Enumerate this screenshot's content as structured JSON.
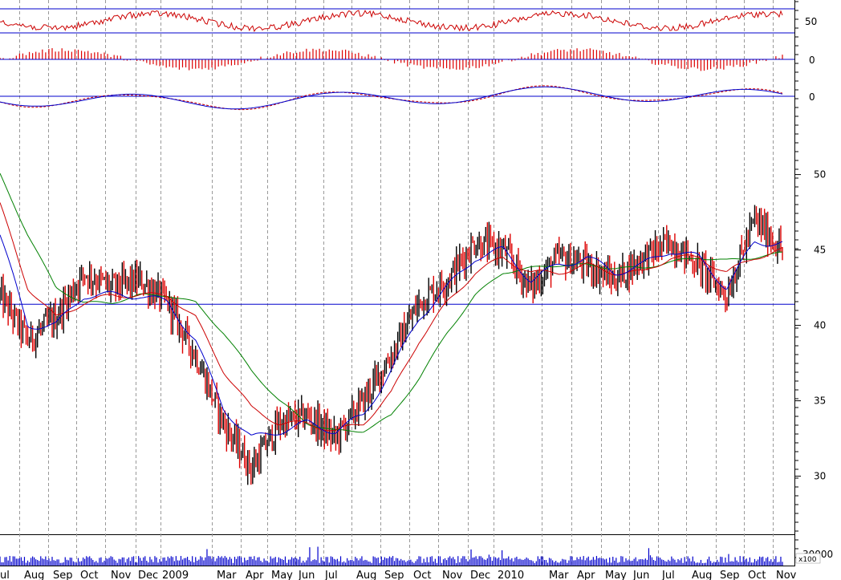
{
  "chart_data": [
    {
      "panel": "oscillator-1",
      "type": "line",
      "reference_levels": [
        50
      ],
      "y_tick_labels": [
        "50"
      ],
      "colors": {
        "line": "#cc0000",
        "reference": "#0000cc"
      }
    },
    {
      "panel": "histogram",
      "type": "bar",
      "reference_levels": [
        0
      ],
      "y_tick_labels": [
        "0"
      ],
      "colors": {
        "bars": "#dd0000",
        "reference": "#0000cc"
      }
    },
    {
      "panel": "oscillator-2",
      "type": "line",
      "reference_levels": [
        0
      ],
      "y_tick_labels": [
        "0"
      ],
      "colors": {
        "line": "#0000cc",
        "signal": "#cc0000",
        "reference": "#0000cc"
      }
    },
    {
      "panel": "price",
      "type": "candlestick",
      "ylim": [
        27,
        52
      ],
      "y_ticks": [
        30,
        35,
        40,
        45,
        50
      ],
      "y_tick_labels": [
        "30",
        "35",
        "40",
        "45",
        "50"
      ],
      "support_level": 41.4,
      "x": [
        "2008-07",
        "2008-08",
        "2008-09",
        "2008-10",
        "2008-11",
        "2008-12",
        "2009-01",
        "2009-02",
        "2009-03",
        "2009-04",
        "2009-05",
        "2009-06",
        "2009-07",
        "2009-08",
        "2009-09",
        "2009-10",
        "2009-11",
        "2009-12",
        "2010-01",
        "2010-02",
        "2010-03",
        "2010-04",
        "2010-05",
        "2010-06",
        "2010-07",
        "2010-08",
        "2010-09",
        "2010-10",
        "2010-11"
      ],
      "close": [
        42.0,
        39.0,
        40.5,
        43.5,
        42.5,
        43.0,
        41.5,
        38.0,
        33.5,
        30.5,
        33.5,
        34.0,
        32.5,
        35.0,
        38.0,
        41.5,
        43.0,
        45.5,
        45.0,
        42.5,
        44.5,
        44.0,
        43.0,
        44.5,
        45.5,
        44.0,
        42.0,
        47.0,
        45.0
      ],
      "series": [
        {
          "name": "",
          "kind": "moving-average",
          "color": "#0000cc",
          "values": [
            46.0,
            40.0,
            40.0,
            42.0,
            42.0,
            42.0,
            41.5,
            39.0,
            34.5,
            32.5,
            33.0,
            33.5,
            33.0,
            34.0,
            37.0,
            40.5,
            42.5,
            44.5,
            45.0,
            43.0,
            44.0,
            44.5,
            43.5,
            44.0,
            45.0,
            44.5,
            42.5,
            45.5,
            45.5
          ]
        },
        {
          "name": "",
          "kind": "moving-average",
          "color": "#cc0000",
          "values": [
            48.0,
            42.5,
            40.5,
            41.5,
            42.0,
            42.0,
            42.0,
            40.5,
            37.0,
            34.5,
            33.5,
            33.5,
            33.0,
            33.5,
            35.5,
            39.0,
            41.5,
            43.5,
            44.5,
            43.5,
            43.5,
            44.0,
            43.5,
            43.5,
            44.5,
            44.5,
            43.5,
            44.5,
            45.0
          ]
        },
        {
          "name": "",
          "kind": "moving-average",
          "color": "#008000",
          "values": [
            50.0,
            46.0,
            42.5,
            41.5,
            41.5,
            42.0,
            42.0,
            41.5,
            39.5,
            37.0,
            35.0,
            33.5,
            33.0,
            33.0,
            34.0,
            36.5,
            39.5,
            42.0,
            43.5,
            43.8,
            44.0,
            44.0,
            43.8,
            43.8,
            44.2,
            44.5,
            44.3,
            44.5,
            44.8
          ]
        }
      ],
      "colors": {
        "up": "#000000",
        "down": "#dd0000",
        "support": "#0000cc",
        "gridline": "#999999"
      }
    },
    {
      "panel": "volume",
      "type": "bar",
      "y_tick_labels": [
        "30000"
      ],
      "scale_label": "x100",
      "colors": {
        "bars": "#0000cc"
      }
    }
  ],
  "x_axis": {
    "month_labels": [
      "ul",
      "Aug",
      "Sep",
      "Oct",
      "Nov",
      "Dec",
      "2009",
      "Mar",
      "Apr",
      "May",
      "Jun",
      "Jul",
      "Aug",
      "Sep",
      "Oct",
      "Nov",
      "Dec",
      "2010",
      "Mar",
      "Apr",
      "May",
      "Jun",
      "Jul",
      "Aug",
      "Sep",
      "Oct",
      "Nov"
    ]
  }
}
